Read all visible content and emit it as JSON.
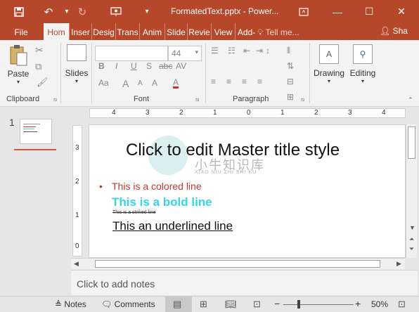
{
  "titlebar": {
    "title": "FormatedText.pptx - Power...",
    "save_icon": "save-icon",
    "undo_icon": "undo-icon",
    "redo_icon": "redo-icon",
    "present_icon": "start-presentation-icon",
    "customize_icon": "customize-toolbar-icon",
    "ribbon_display_icon": "ribbon-display-options-icon",
    "minimize_glyph": "—",
    "maximize_glyph": "☐",
    "close_glyph": "✕"
  },
  "tabs": {
    "file": "File",
    "home": "Hom",
    "insert": "Inser",
    "design": "Desig",
    "transitions": "Trans",
    "animations": "Anim",
    "slideshow": "Slide",
    "review": "Revie",
    "view": "View",
    "addins": "Add-",
    "tellme": "Tell me...",
    "share": "Sha"
  },
  "ribbon": {
    "paste_label": "Paste",
    "slides_label": "Slides",
    "drawing_label": "Drawing",
    "editing_label": "Editing",
    "font_size_value": "44",
    "clipboard_group": "Clipboard",
    "font_group": "Font",
    "paragraph_group": "Paragraph",
    "bold_glyph": "B",
    "italic_glyph": "I",
    "underline_glyph": "U",
    "shadow_glyph": "S",
    "strike_glyph": "abc",
    "spacing_glyph": "AV",
    "case_glyph": "Aa",
    "grow_glyph": "A",
    "shrink_glyph": "A",
    "clear_glyph": "A",
    "color_glyph": "A"
  },
  "thumbnails": {
    "slide_number": "1"
  },
  "ruler": {
    "h_labels": [
      "4",
      "3",
      "2",
      "1",
      "0",
      "1",
      "2",
      "3",
      "4"
    ],
    "v_labels": [
      "3",
      "2",
      "1",
      "0"
    ]
  },
  "slide": {
    "title": "Click to edit Master title style",
    "bullet_colored": "This is a colored line",
    "bold_line": "This is a bold line",
    "struck_line": "This is a striked line",
    "underlined_line": "This an underlined line",
    "watermark_text": "小牛知识库",
    "watermark_sub": "XIAO NIU ZHI SHI KU"
  },
  "notes": {
    "placeholder": "Click to add notes"
  },
  "statusbar": {
    "notes_label": "Notes",
    "comments_label": "Comments",
    "zoom_out": "−",
    "zoom_in": "+",
    "zoom": "50%"
  },
  "colors": {
    "accent": "#b7472a",
    "colored_line": "#c0392b",
    "bold_line": "#33d6e8"
  }
}
